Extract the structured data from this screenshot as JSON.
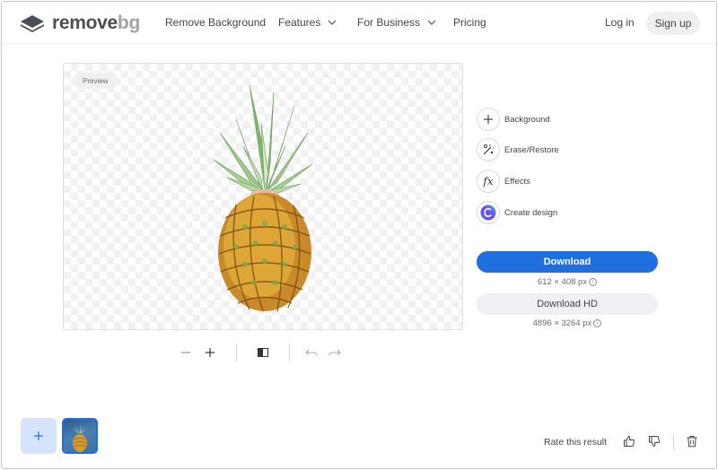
{
  "header": {
    "logo": {
      "word1": "remove",
      "word2": "bg",
      "icon": "layers-logo-icon"
    },
    "nav": {
      "remove_background": "Remove Background",
      "features": "Features",
      "for_business": "For Business",
      "pricing": "Pricing"
    },
    "login": "Log in",
    "signup": "Sign up"
  },
  "canvas": {
    "badge": "Preview",
    "image_subject": "pineapple"
  },
  "toolbar": {
    "icons": [
      "minus-icon",
      "plus-icon",
      "compare-icon",
      "undo-icon",
      "redo-icon"
    ]
  },
  "tools": {
    "background": "Background",
    "erase_restore": "Erase/Restore",
    "effects": "Effects",
    "effects_glyph": "fx",
    "create_design": "Create design"
  },
  "download": {
    "label": "Download",
    "size": "612 × 408 px"
  },
  "download_hd": {
    "label": "Download HD",
    "size": "4896 × 3264 px"
  },
  "bottom": {
    "rate": "Rate this result"
  },
  "colors": {
    "accent": "#1f6fe0",
    "pill_bg": "#eef0f3",
    "add_tile": "#d6e4fb",
    "logo_dark": "#4a4f55",
    "logo_light": "#9ea3a8"
  }
}
